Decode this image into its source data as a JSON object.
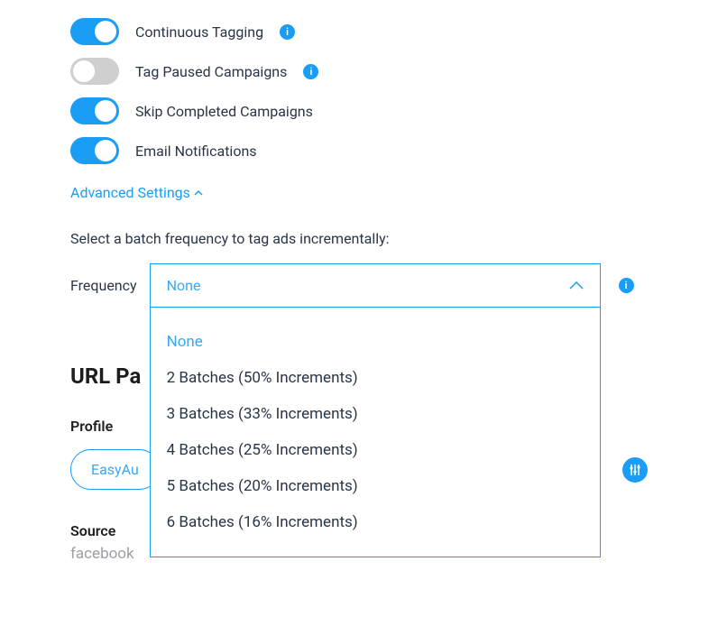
{
  "colors": {
    "accent": "#1a9df4",
    "text": "#2a3548",
    "muted": "#9aa0a6"
  },
  "switches": {
    "continuous_tagging": {
      "label": "Continuous Tagging",
      "on": true,
      "info": true
    },
    "tag_paused": {
      "label": "Tag Paused Campaigns",
      "on": false,
      "info": true
    },
    "skip_completed": {
      "label": "Skip Completed Campaigns",
      "on": true,
      "info": false
    },
    "email_notifications": {
      "label": "Email Notifications",
      "on": true,
      "info": false
    }
  },
  "advanced_settings_label": "Advanced Settings",
  "batch": {
    "prompt": "Select a batch frequency to tag ads incrementally:",
    "frequency_label": "Frequency",
    "selected": "None",
    "options": [
      "None",
      "2 Batches (50% Increments)",
      "3 Batches (33% Increments)",
      "4 Batches (25% Increments)",
      "5 Batches (20% Increments)",
      "6 Batches (16% Increments)"
    ]
  },
  "url_params": {
    "heading": "URL Pa",
    "profile_label": "Profile",
    "profile_visible_text": "EasyAu",
    "source_label": "Source",
    "source_value": "facebook"
  }
}
